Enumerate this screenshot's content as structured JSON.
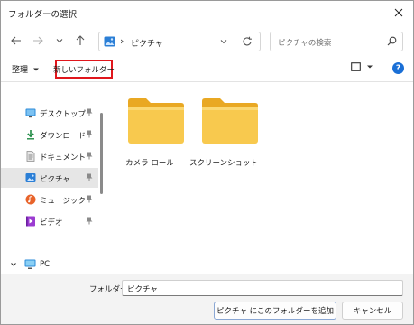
{
  "window": {
    "title": "フォルダーの選択"
  },
  "nav": {
    "location": "ピクチャ",
    "separator": "›"
  },
  "search": {
    "placeholder": "ピクチャの検索"
  },
  "toolbar": {
    "organize": "整理",
    "new_folder": "新しいフォルダー",
    "help": "?"
  },
  "sidebar": {
    "items": [
      {
        "label": "デスクトップ",
        "icon": "desktop-icon",
        "pinned": true
      },
      {
        "label": "ダウンロード",
        "icon": "download-icon",
        "pinned": true
      },
      {
        "label": "ドキュメント",
        "icon": "document-icon",
        "pinned": true
      },
      {
        "label": "ピクチャ",
        "icon": "picture-icon",
        "pinned": true,
        "selected": true
      },
      {
        "label": "ミュージック",
        "icon": "music-icon",
        "pinned": true
      },
      {
        "label": "ビデオ",
        "icon": "video-icon",
        "pinned": true
      }
    ],
    "pc": {
      "label": "PC",
      "icon": "pc-icon"
    }
  },
  "folders": [
    {
      "name": "カメラ ロール"
    },
    {
      "name": "スクリーンショット"
    }
  ],
  "footer": {
    "folder_label": "フォルダー:",
    "folder_value": "ピクチャ",
    "select_button": "ピクチャ にこのフォルダーを追加",
    "cancel_button": "キャンセル"
  },
  "colors": {
    "accent": "#1a6fd6",
    "highlight_box": "#e0161c",
    "folder_yellow": "#f5c242"
  }
}
